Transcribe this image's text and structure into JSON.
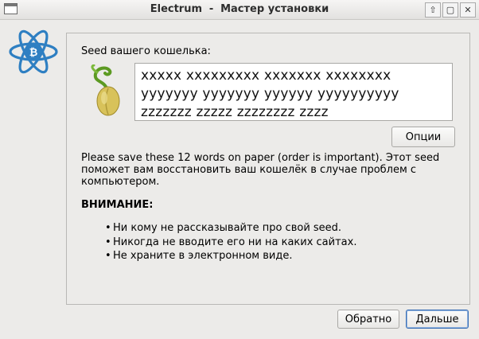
{
  "window": {
    "title_app": "Electrum",
    "title_sep": "-",
    "title_page": "Мастер установки",
    "buttons": {
      "restore_icon": "⇧",
      "maximize_icon": "▢",
      "close_icon": "✕"
    }
  },
  "seed": {
    "label": "Seed вашего кошелька:",
    "text": "xxxxx xxxxxxxxx xxxxxxx xxxxxxxx yyyyyyy yyyyyyy yyyyyy yyyyyyyyyy zzzzzzz zzzzz zzzzzzzz zzzz"
  },
  "options_button": "Опции",
  "info_text": "Please save these 12 words on paper (order is important). Этот seed поможет вам восстановить ваш кошелёк в случае проблем с компьютером.",
  "warning": {
    "title": "ВНИМАНИЕ:",
    "bullet": "•",
    "items": [
      "Ни кому не рассказывайте про свой seed.",
      "Никогда не вводите его ни на каких сайтах.",
      "Не храните в электронном виде."
    ]
  },
  "footer": {
    "back": "Обратно",
    "next": "Дальше"
  },
  "colors": {
    "logo_blue": "#2e7fc2",
    "accent": "#3a6fb5",
    "sprout_green": "#5c9a22",
    "seed_yellow": "#d8c25a"
  }
}
